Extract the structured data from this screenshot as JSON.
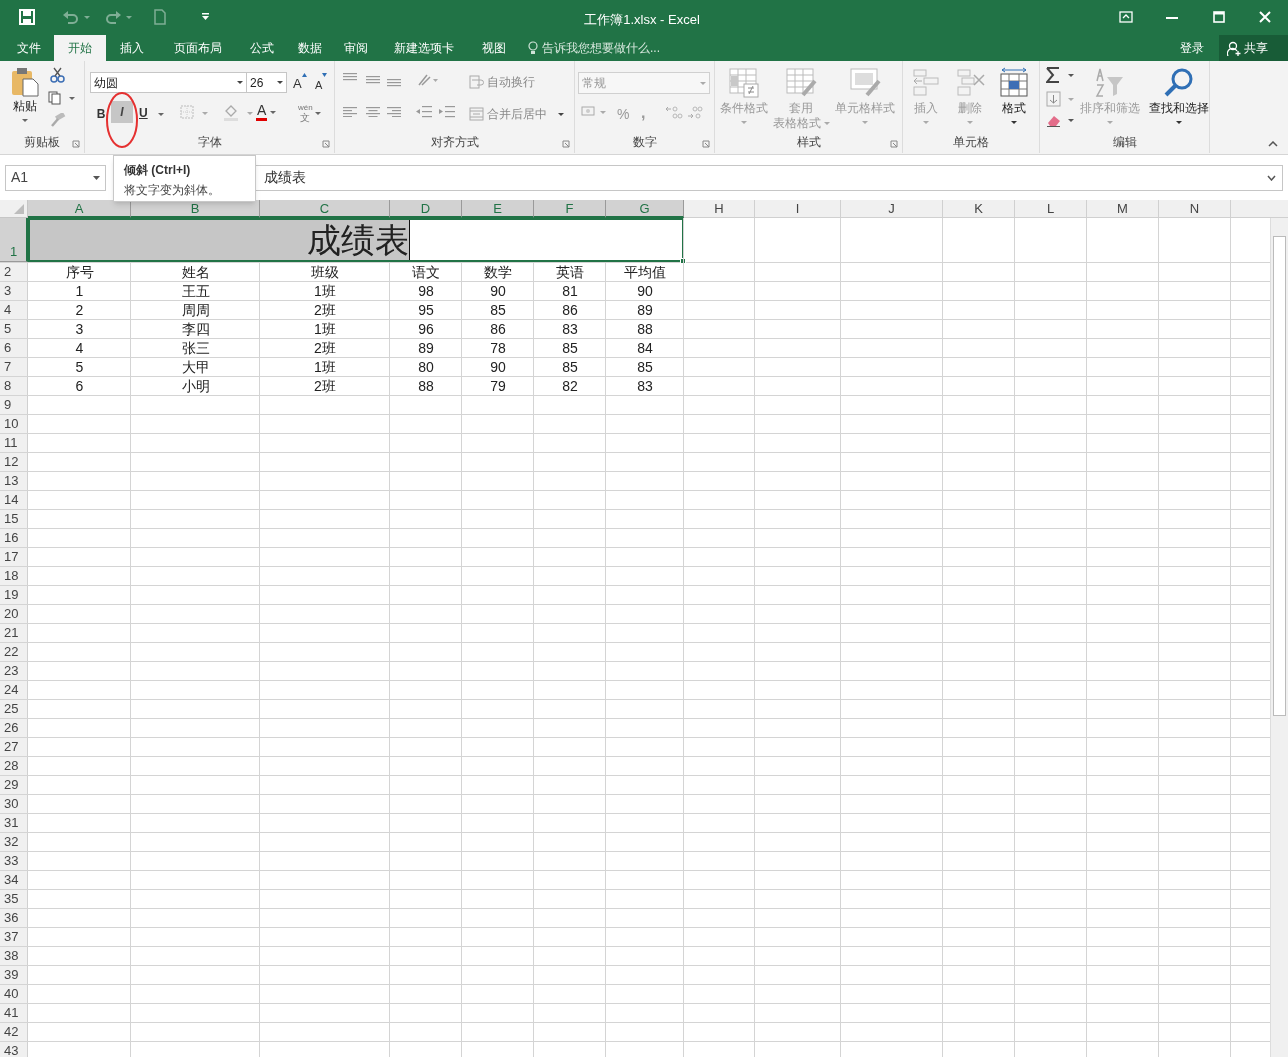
{
  "window": {
    "title": "工作簿1.xlsx - Excel"
  },
  "tabs": [
    {
      "label": "文件",
      "selected": false
    },
    {
      "label": "开始",
      "selected": true
    },
    {
      "label": "插入",
      "selected": false
    },
    {
      "label": "页面布局",
      "selected": false
    },
    {
      "label": "公式",
      "selected": false
    },
    {
      "label": "数据",
      "selected": false
    },
    {
      "label": "审阅",
      "selected": false
    },
    {
      "label": "新建选项卡",
      "selected": false
    },
    {
      "label": "视图",
      "selected": false
    }
  ],
  "tell_me": {
    "placeholder": "告诉我您想要做什么..."
  },
  "account": {
    "sign_in": "登录",
    "share": "共享"
  },
  "ribbon": {
    "clipboard": {
      "paste": "粘贴",
      "label": "剪贴板"
    },
    "font": {
      "font_name": "幼圆",
      "font_size": "26",
      "label": "字体",
      "bold": "B",
      "italic": "I",
      "underline": "U",
      "italic_hovered": true,
      "phonetic": "wén",
      "phonetic_char": "文",
      "grow": "A",
      "shrink": "A",
      "font_color": "A"
    },
    "alignment": {
      "wrap": "自动换行",
      "merge": "合并后居中",
      "label": "对齐方式"
    },
    "number": {
      "format": "常规",
      "percent": "%",
      "comma": ",",
      "label": "数字"
    },
    "styles": {
      "buttons": [
        {
          "label": "条件格式",
          "disabled": true
        },
        {
          "label": "套用",
          "label_2": "表格格式",
          "disabled": true
        },
        {
          "label": "单元格样式",
          "disabled": true
        }
      ],
      "label": "样式"
    },
    "cells": {
      "buttons": [
        {
          "label": "插入",
          "disabled": true
        },
        {
          "label": "删除",
          "disabled": true
        },
        {
          "label": "格式",
          "disabled": false
        }
      ],
      "label": "单元格"
    },
    "editing": {
      "buttons": [
        {
          "label": "排序和筛选",
          "disabled": true
        },
        {
          "label": "查找和选择",
          "disabled": false
        }
      ],
      "label": "编辑"
    }
  },
  "tooltip": {
    "title": "倾斜 (Ctrl+I)",
    "text": "将文字变为斜体。"
  },
  "formula_bar": {
    "name_box": "A1",
    "value": "成绩表"
  },
  "sheet": {
    "columns": [
      {
        "letter": "A",
        "selected": true
      },
      {
        "letter": "B",
        "selected": true
      },
      {
        "letter": "C",
        "selected": true
      },
      {
        "letter": "D",
        "selected": true
      },
      {
        "letter": "E",
        "selected": true
      },
      {
        "letter": "F",
        "selected": true
      },
      {
        "letter": "G",
        "selected": true
      },
      {
        "letter": "H",
        "selected": false
      },
      {
        "letter": "I",
        "selected": false
      },
      {
        "letter": "J",
        "selected": false
      },
      {
        "letter": "K",
        "selected": false
      },
      {
        "letter": "L",
        "selected": false
      },
      {
        "letter": "M",
        "selected": false
      },
      {
        "letter": "N",
        "selected": false
      }
    ],
    "title_row": {
      "number": "1",
      "text": "成绩表",
      "editing": true
    },
    "rows": [
      {
        "number": "2",
        "cells": [
          "序号",
          "姓名",
          "班级",
          "语文",
          "数学",
          "英语",
          "平均值"
        ]
      },
      {
        "number": "3",
        "cells": [
          "1",
          "王五",
          "1班",
          "98",
          "90",
          "81",
          "90"
        ]
      },
      {
        "number": "4",
        "cells": [
          "2",
          "周周",
          "2班",
          "95",
          "85",
          "86",
          "89"
        ]
      },
      {
        "number": "5",
        "cells": [
          "3",
          "李四",
          "1班",
          "96",
          "86",
          "83",
          "88"
        ]
      },
      {
        "number": "6",
        "cells": [
          "4",
          "张三",
          "2班",
          "89",
          "78",
          "85",
          "84"
        ]
      },
      {
        "number": "7",
        "cells": [
          "5",
          "大甲",
          "1班",
          "80",
          "90",
          "85",
          "85"
        ]
      },
      {
        "number": "8",
        "cells": [
          "6",
          "小明",
          "2班",
          "88",
          "79",
          "82",
          "83"
        ]
      },
      {
        "number": "9"
      },
      {
        "number": "10"
      },
      {
        "number": "11"
      },
      {
        "number": "12"
      },
      {
        "number": "13"
      },
      {
        "number": "14"
      },
      {
        "number": "15"
      },
      {
        "number": "16"
      },
      {
        "number": "17"
      },
      {
        "number": "18"
      },
      {
        "number": "19"
      },
      {
        "number": "20"
      },
      {
        "number": "21"
      },
      {
        "number": "22"
      },
      {
        "number": "23"
      },
      {
        "number": "24"
      },
      {
        "number": "25"
      },
      {
        "number": "26"
      },
      {
        "number": "27"
      },
      {
        "number": "28"
      },
      {
        "number": "29"
      },
      {
        "number": "30"
      },
      {
        "number": "31"
      },
      {
        "number": "32"
      },
      {
        "number": "33"
      },
      {
        "number": "34"
      },
      {
        "number": "35"
      },
      {
        "number": "36"
      },
      {
        "number": "37"
      },
      {
        "number": "38"
      },
      {
        "number": "39"
      },
      {
        "number": "40"
      },
      {
        "number": "41"
      },
      {
        "number": "42"
      },
      {
        "number": "43"
      }
    ]
  }
}
